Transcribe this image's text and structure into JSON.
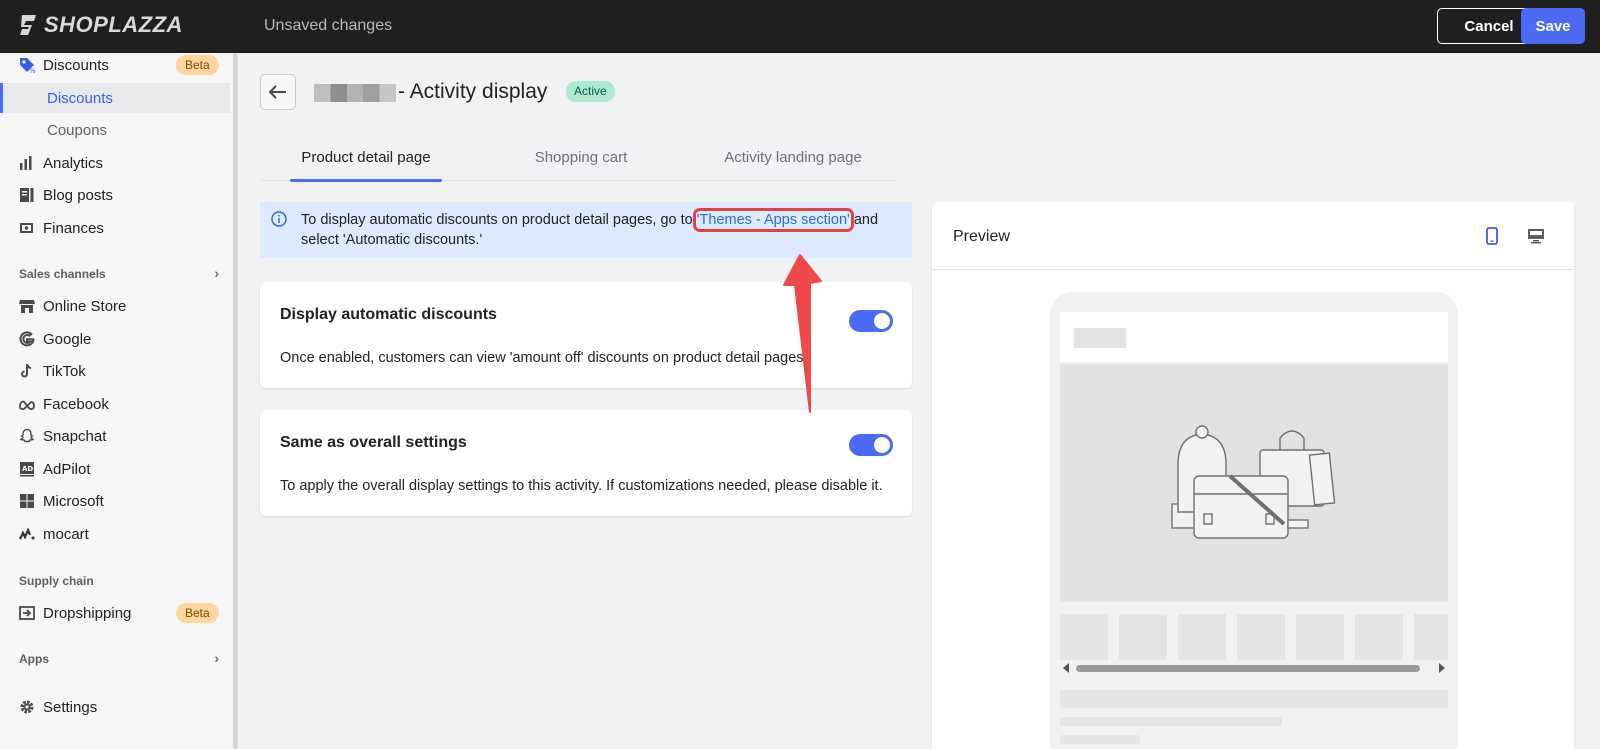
{
  "topbar": {
    "logo_text": "SHOPLAZZA",
    "status": "Unsaved changes",
    "cancel_label": "Cancel",
    "save_label": "Save"
  },
  "sidebar": {
    "discounts": {
      "label": "Discounts",
      "badge": "Beta",
      "icon": "discount-tag-icon"
    },
    "sub_items": [
      {
        "label": "Discounts",
        "active": true
      },
      {
        "label": "Coupons",
        "active": false
      }
    ],
    "items": [
      {
        "label": "Analytics",
        "icon": "bar-chart-icon"
      },
      {
        "label": "Blog posts",
        "icon": "blog-icon"
      },
      {
        "label": "Finances",
        "icon": "finances-icon"
      }
    ],
    "sales_channels_header": "Sales channels",
    "sales_channels": [
      {
        "label": "Online Store",
        "icon": "store-icon"
      },
      {
        "label": "Google",
        "icon": "google-icon"
      },
      {
        "label": "TikTok",
        "icon": "tiktok-icon"
      },
      {
        "label": "Facebook",
        "icon": "meta-icon"
      },
      {
        "label": "Snapchat",
        "icon": "snapchat-icon"
      },
      {
        "label": "AdPilot",
        "icon": "adpilot-icon"
      },
      {
        "label": "Microsoft",
        "icon": "microsoft-icon"
      },
      {
        "label": "mocart",
        "icon": "mocart-icon"
      }
    ],
    "supply_chain_header": "Supply chain",
    "dropshipping": {
      "label": "Dropshipping",
      "badge": "Beta",
      "icon": "dropshipping-icon"
    },
    "apps_header": "Apps",
    "settings": {
      "label": "Settings",
      "icon": "gear-icon"
    }
  },
  "page": {
    "title": "- Activity display",
    "status_badge": "Active",
    "tabs": [
      {
        "label": "Product detail page",
        "active": true
      },
      {
        "label": "Shopping cart",
        "active": false
      },
      {
        "label": "Activity landing page",
        "active": false
      }
    ],
    "banner": {
      "text_before": "To display automatic discounts on product detail pages, go to ",
      "link": "'Themes - Apps section'",
      "text_after": " and select 'Automatic discounts.'"
    },
    "cards": [
      {
        "title": "Display automatic discounts",
        "description": "Once enabled, customers can view 'amount off' discounts on product detail pages",
        "enabled": true
      },
      {
        "title": "Same as overall settings",
        "description": "To apply the overall display settings to this activity. If customizations needed, please disable it.",
        "enabled": true
      }
    ]
  },
  "preview": {
    "title": "Preview",
    "mobile_icon": "mobile-icon",
    "desktop_icon": "desktop-icon",
    "selected_device": "mobile"
  },
  "colors": {
    "accent": "#4b6bf5",
    "topbar": "#1f1f1f",
    "banner_bg": "#ddeafd",
    "annotation": "#e53e3e",
    "badge_beta": "#ffd79d",
    "badge_active": "#aee9d1"
  }
}
